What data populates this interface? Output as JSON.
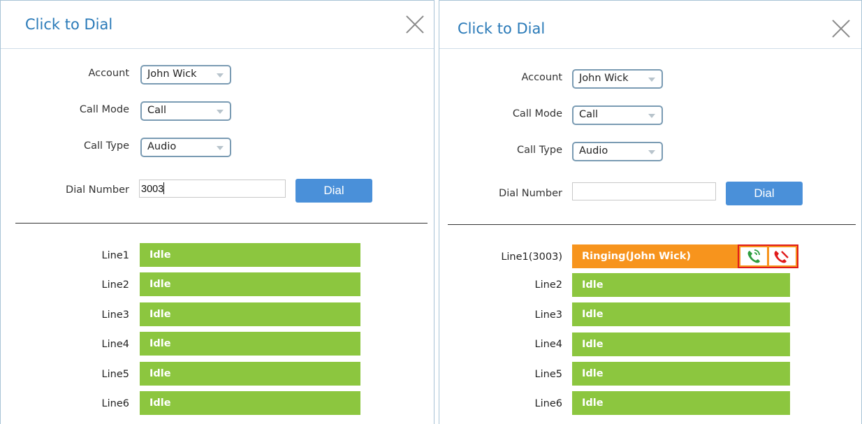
{
  "left": {
    "title": "Click to Dial",
    "account_label": "Account",
    "account_value": "John Wick",
    "mode_label": "Call Mode",
    "mode_value": "Call",
    "type_label": "Call Type",
    "type_value": "Audio",
    "dial_label": "Dial Number",
    "dial_value": "3003",
    "dial_button": "Dial",
    "lines": [
      {
        "label": "Line1",
        "status": "Idle"
      },
      {
        "label": "Line2",
        "status": "Idle"
      },
      {
        "label": "Line3",
        "status": "Idle"
      },
      {
        "label": "Line4",
        "status": "Idle"
      },
      {
        "label": "Line5",
        "status": "Idle"
      },
      {
        "label": "Line6",
        "status": "Idle"
      }
    ]
  },
  "right": {
    "title": "Click to Dial",
    "account_label": "Account",
    "account_value": "John Wick",
    "mode_label": "Call Mode",
    "mode_value": "Call",
    "type_label": "Call Type",
    "type_value": "Audio",
    "dial_label": "Dial Number",
    "dial_value": "",
    "dial_button": "Dial",
    "lines": [
      {
        "label": "Line1(3003)",
        "status": "Ringing(John Wick)"
      },
      {
        "label": "Line2",
        "status": "Idle"
      },
      {
        "label": "Line3",
        "status": "Idle"
      },
      {
        "label": "Line4",
        "status": "Idle"
      },
      {
        "label": "Line5",
        "status": "Idle"
      },
      {
        "label": "Line6",
        "status": "Idle"
      }
    ]
  },
  "icons": {
    "close": "close-icon",
    "dropdown": "chevron-down-icon",
    "answer": "phone-answer-icon",
    "hangup": "phone-hangup-icon"
  },
  "colors": {
    "title": "#2a7ab8",
    "idle": "#8cc63f",
    "ringing": "#f7941d",
    "dial_button": "#4a90d9",
    "answer": "#2e9e3e",
    "hangup": "#e01b1b",
    "highlight": "#e01b1b"
  }
}
